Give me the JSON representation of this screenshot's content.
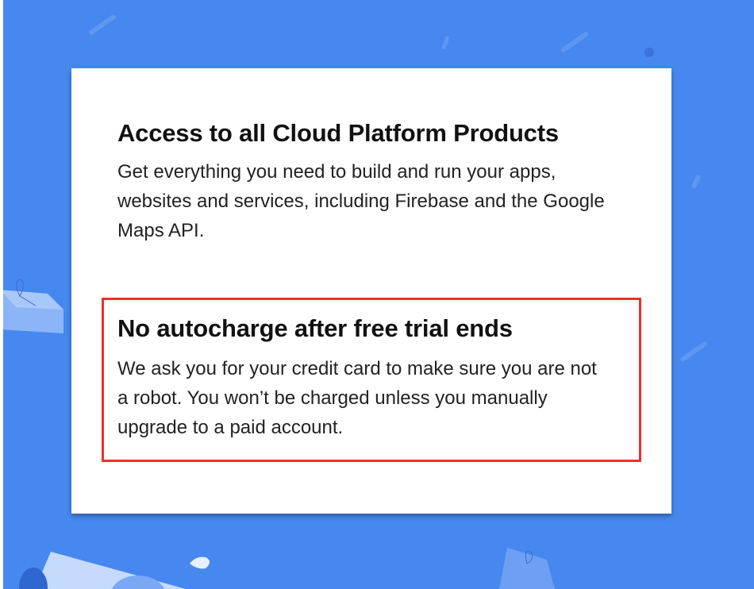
{
  "features": [
    {
      "title": "Access to all Cloud Platform Products",
      "description": "Get everything you need to build and run your apps, websites and services, including Firebase and the Google Maps API."
    },
    {
      "title": "No autocharge after free trial ends",
      "description": "We ask you for your credit card to make sure you are not a robot. You won’t be charged unless you manually upgrade to a paid account."
    }
  ],
  "colors": {
    "background": "#4688ef",
    "highlight": "#f0302a"
  }
}
